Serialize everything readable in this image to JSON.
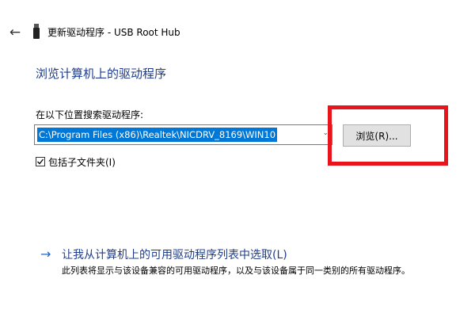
{
  "window": {
    "title": "更新驱动程序 - USB Root Hub",
    "back_icon": "←"
  },
  "page": {
    "heading": "浏览计算机上的驱动程序",
    "search_label": "在以下位置搜索驱动程序:",
    "path_value": "C:\\Program Files (x86)\\Realtek\\NICDRV_8169\\WIN10",
    "combo_arrow_icon": "⌄",
    "browse_label": "浏览(R)...",
    "include_subfolders_label": "包括子文件夹(I)",
    "include_subfolders_checked": true
  },
  "pick": {
    "arrow_icon": "→",
    "link_label": "让我从计算机上的可用驱动程序列表中选取(L)",
    "description": "此列表将显示与该设备兼容的可用驱动程序，以及与该设备属于同一类别的所有驱动程序。"
  },
  "colors": {
    "highlight": "#e8141b",
    "heading": "#1f3d8a",
    "selection": "#0078d7"
  }
}
